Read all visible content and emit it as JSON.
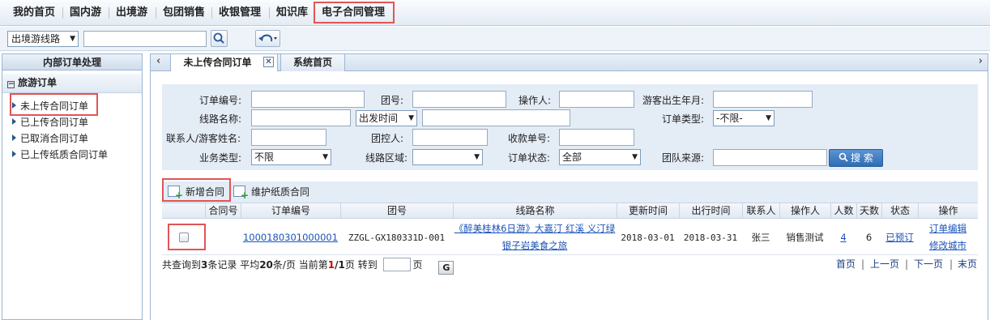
{
  "topnav": {
    "items": [
      "我的首页",
      "国内游",
      "出境游",
      "包团销售",
      "收银管理",
      "知识库",
      "电子合同管理"
    ]
  },
  "toolbar": {
    "route_select": "出境游线路",
    "search_value": ""
  },
  "sidebar": {
    "header": "内部订单处理",
    "group": "旅游订单",
    "items": [
      "未上传合同订单",
      "已上传合同订单",
      "已取消合同订单",
      "已上传纸质合同订单"
    ]
  },
  "tabs": [
    "未上传合同订单",
    "系统首页"
  ],
  "search": {
    "order_no_label": "订单编号:",
    "group_no_label": "团号:",
    "operator_label": "操作人:",
    "birth_label": "游客出生年月:",
    "route_label": "线路名称:",
    "depart_select": "出发时间",
    "order_type_label": "订单类型:",
    "order_type_value": "-不限-",
    "contact_label": "联系人/游客姓名:",
    "controller_label": "团控人:",
    "receipt_label": "收款单号:",
    "biz_type_label": "业务类型:",
    "biz_type_value": "不限",
    "area_label": "线路区域:",
    "area_value": "",
    "status_label": "订单状态:",
    "status_value": "全部",
    "source_label": "团队来源:",
    "search_button": "搜 索"
  },
  "actions": {
    "add": "新增合同",
    "maintain": "维护纸质合同"
  },
  "table": {
    "headers": [
      "合同号",
      "订单编号",
      "团号",
      "线路名称",
      "更新时间",
      "出行时间",
      "联系人",
      "操作人",
      "人数",
      "天数",
      "状态",
      "操作"
    ],
    "rows": [
      {
        "contract_no": "",
        "order_no": "1000180301000001",
        "group_no": "ZZGL-GX180331D-001",
        "route_line1": "《醉美桂林6日游》大嘉汀 红溪 义汀绿",
        "route_line2": "银子岩美食之旅",
        "updated": "2018-03-01",
        "travel_date": "2018-03-31",
        "contact": "张三",
        "operator": "销售测试",
        "people": "4",
        "days": "6",
        "status": "已预订",
        "op1": "订单编辑",
        "op2": "修改城市"
      }
    ]
  },
  "pager": {
    "t1": "共查询到",
    "total": "3",
    "t2": "条记录 平均",
    "per_page": "20",
    "t3": "条/页 当前第",
    "current": "1",
    "slash": "/",
    "pages": "1",
    "t4": "页 转到",
    "t5": "页",
    "go": "G",
    "first": "首页",
    "prev": "上一页",
    "next": "下一页",
    "last": "末页",
    "sep": "|"
  }
}
